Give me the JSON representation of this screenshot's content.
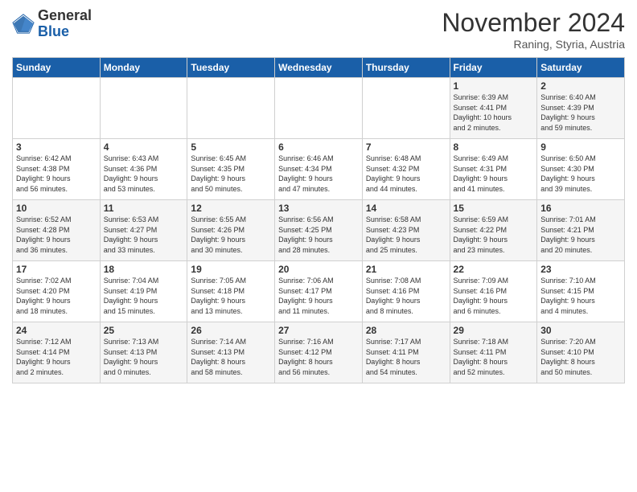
{
  "header": {
    "logo_line1": "General",
    "logo_line2": "Blue",
    "month": "November 2024",
    "location": "Raning, Styria, Austria"
  },
  "days_of_week": [
    "Sunday",
    "Monday",
    "Tuesday",
    "Wednesday",
    "Thursday",
    "Friday",
    "Saturday"
  ],
  "weeks": [
    [
      {
        "day": "",
        "info": ""
      },
      {
        "day": "",
        "info": ""
      },
      {
        "day": "",
        "info": ""
      },
      {
        "day": "",
        "info": ""
      },
      {
        "day": "",
        "info": ""
      },
      {
        "day": "1",
        "info": "Sunrise: 6:39 AM\nSunset: 4:41 PM\nDaylight: 10 hours\nand 2 minutes."
      },
      {
        "day": "2",
        "info": "Sunrise: 6:40 AM\nSunset: 4:39 PM\nDaylight: 9 hours\nand 59 minutes."
      }
    ],
    [
      {
        "day": "3",
        "info": "Sunrise: 6:42 AM\nSunset: 4:38 PM\nDaylight: 9 hours\nand 56 minutes."
      },
      {
        "day": "4",
        "info": "Sunrise: 6:43 AM\nSunset: 4:36 PM\nDaylight: 9 hours\nand 53 minutes."
      },
      {
        "day": "5",
        "info": "Sunrise: 6:45 AM\nSunset: 4:35 PM\nDaylight: 9 hours\nand 50 minutes."
      },
      {
        "day": "6",
        "info": "Sunrise: 6:46 AM\nSunset: 4:34 PM\nDaylight: 9 hours\nand 47 minutes."
      },
      {
        "day": "7",
        "info": "Sunrise: 6:48 AM\nSunset: 4:32 PM\nDaylight: 9 hours\nand 44 minutes."
      },
      {
        "day": "8",
        "info": "Sunrise: 6:49 AM\nSunset: 4:31 PM\nDaylight: 9 hours\nand 41 minutes."
      },
      {
        "day": "9",
        "info": "Sunrise: 6:50 AM\nSunset: 4:30 PM\nDaylight: 9 hours\nand 39 minutes."
      }
    ],
    [
      {
        "day": "10",
        "info": "Sunrise: 6:52 AM\nSunset: 4:28 PM\nDaylight: 9 hours\nand 36 minutes."
      },
      {
        "day": "11",
        "info": "Sunrise: 6:53 AM\nSunset: 4:27 PM\nDaylight: 9 hours\nand 33 minutes."
      },
      {
        "day": "12",
        "info": "Sunrise: 6:55 AM\nSunset: 4:26 PM\nDaylight: 9 hours\nand 30 minutes."
      },
      {
        "day": "13",
        "info": "Sunrise: 6:56 AM\nSunset: 4:25 PM\nDaylight: 9 hours\nand 28 minutes."
      },
      {
        "day": "14",
        "info": "Sunrise: 6:58 AM\nSunset: 4:23 PM\nDaylight: 9 hours\nand 25 minutes."
      },
      {
        "day": "15",
        "info": "Sunrise: 6:59 AM\nSunset: 4:22 PM\nDaylight: 9 hours\nand 23 minutes."
      },
      {
        "day": "16",
        "info": "Sunrise: 7:01 AM\nSunset: 4:21 PM\nDaylight: 9 hours\nand 20 minutes."
      }
    ],
    [
      {
        "day": "17",
        "info": "Sunrise: 7:02 AM\nSunset: 4:20 PM\nDaylight: 9 hours\nand 18 minutes."
      },
      {
        "day": "18",
        "info": "Sunrise: 7:04 AM\nSunset: 4:19 PM\nDaylight: 9 hours\nand 15 minutes."
      },
      {
        "day": "19",
        "info": "Sunrise: 7:05 AM\nSunset: 4:18 PM\nDaylight: 9 hours\nand 13 minutes."
      },
      {
        "day": "20",
        "info": "Sunrise: 7:06 AM\nSunset: 4:17 PM\nDaylight: 9 hours\nand 11 minutes."
      },
      {
        "day": "21",
        "info": "Sunrise: 7:08 AM\nSunset: 4:16 PM\nDaylight: 9 hours\nand 8 minutes."
      },
      {
        "day": "22",
        "info": "Sunrise: 7:09 AM\nSunset: 4:16 PM\nDaylight: 9 hours\nand 6 minutes."
      },
      {
        "day": "23",
        "info": "Sunrise: 7:10 AM\nSunset: 4:15 PM\nDaylight: 9 hours\nand 4 minutes."
      }
    ],
    [
      {
        "day": "24",
        "info": "Sunrise: 7:12 AM\nSunset: 4:14 PM\nDaylight: 9 hours\nand 2 minutes."
      },
      {
        "day": "25",
        "info": "Sunrise: 7:13 AM\nSunset: 4:13 PM\nDaylight: 9 hours\nand 0 minutes."
      },
      {
        "day": "26",
        "info": "Sunrise: 7:14 AM\nSunset: 4:13 PM\nDaylight: 8 hours\nand 58 minutes."
      },
      {
        "day": "27",
        "info": "Sunrise: 7:16 AM\nSunset: 4:12 PM\nDaylight: 8 hours\nand 56 minutes."
      },
      {
        "day": "28",
        "info": "Sunrise: 7:17 AM\nSunset: 4:11 PM\nDaylight: 8 hours\nand 54 minutes."
      },
      {
        "day": "29",
        "info": "Sunrise: 7:18 AM\nSunset: 4:11 PM\nDaylight: 8 hours\nand 52 minutes."
      },
      {
        "day": "30",
        "info": "Sunrise: 7:20 AM\nSunset: 4:10 PM\nDaylight: 8 hours\nand 50 minutes."
      }
    ]
  ]
}
